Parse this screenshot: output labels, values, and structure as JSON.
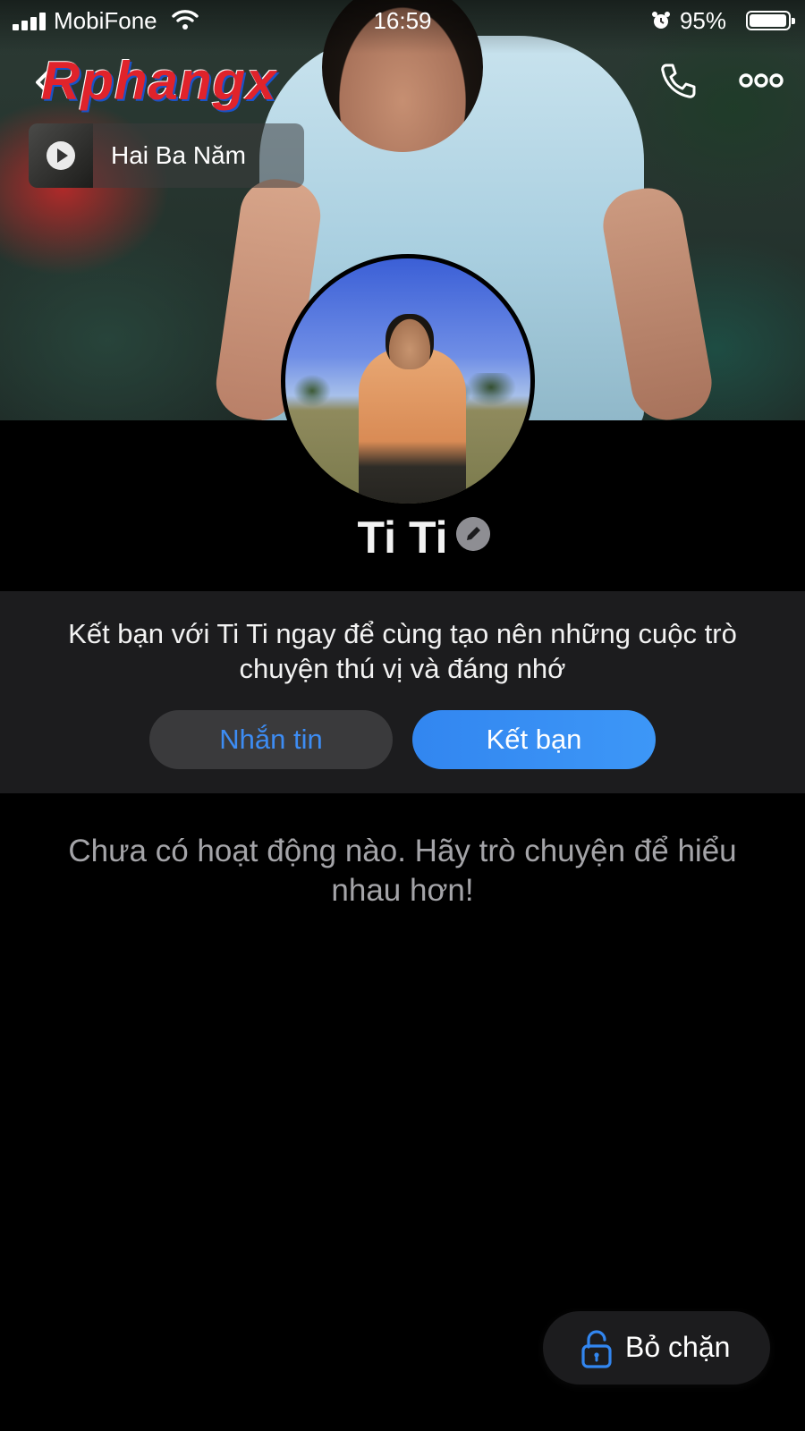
{
  "status_bar": {
    "carrier": "MobiFone",
    "time": "16:59",
    "battery_percent": "95%"
  },
  "watermark": "Rphangx",
  "music": {
    "title": "Hai Ba Năm"
  },
  "profile": {
    "name": "Ti Ti"
  },
  "friend_card": {
    "prompt": "Kết bạn với Ti Ti ngay để cùng tạo nên những cuộc trò chuyện thú vị và đáng nhớ",
    "message_label": "Nhắn tin",
    "add_friend_label": "Kết bạn"
  },
  "activity": {
    "empty_text": "Chưa có hoạt động nào. Hãy trò chuyện để hiểu nhau hơn!"
  },
  "unblock": {
    "label": "Bỏ chặn"
  },
  "colors": {
    "accent_blue": "#3286f0",
    "card_bg": "#1c1c1e",
    "secondary_text": "#a4a4a8"
  },
  "icons": [
    "signal-icon",
    "wifi-icon",
    "alarm-icon",
    "battery-icon",
    "back-icon",
    "phone-icon",
    "more-icon",
    "play-icon",
    "edit-icon",
    "unlock-icon"
  ]
}
